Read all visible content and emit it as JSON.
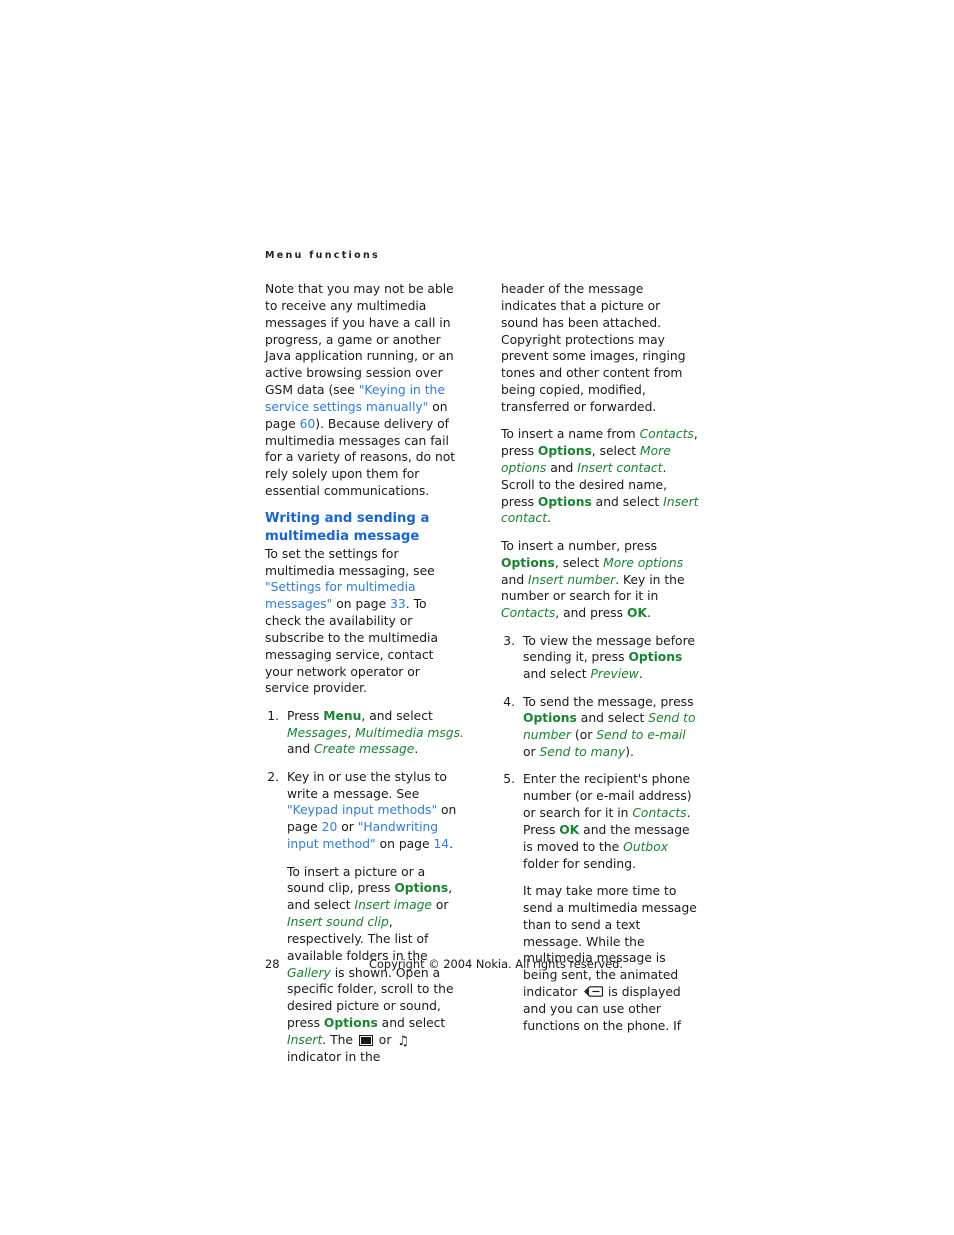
{
  "running_head": "Menu functions",
  "left_column": {
    "intro_paragraph": {
      "part1": "Note that you may not be able to receive any multimedia messages if you have a call in progress, a game or another Java application running, or an active browsing session over GSM data (see ",
      "link1": "\"Keying in the service settings manually\"",
      "part2": " on page ",
      "page1": "60",
      "part3": "). Because delivery of multimedia messages can fail for a variety of reasons, do not rely solely upon them for essential communications."
    },
    "section_title": "Writing and sending a multimedia message",
    "settings_paragraph": {
      "part1": "To set the settings for multimedia messaging, see ",
      "link1": "\"Settings for multimedia messages\"",
      "part2": " on page ",
      "page1": "33",
      "part3": ". To check the availability or subscribe to the multimedia messaging service, contact your network operator or service provider."
    },
    "steps": [
      {
        "num": "1.",
        "part1": "Press ",
        "key1": "Menu",
        "part2": ", and select ",
        "menu1": "Messages",
        "part3": ", ",
        "menu2": "Multimedia msgs.",
        "part4": " and ",
        "menu3": "Create message",
        "part5": "."
      },
      {
        "num": "2.",
        "p1_part1": "Key in or use the stylus to write a message. See ",
        "p1_link1": "\"Keypad input methods\"",
        "p1_part2": " on page ",
        "p1_page1": "20",
        "p1_part3": " or ",
        "p1_link2": "\"Handwriting input method\"",
        "p1_part4": " on page ",
        "p1_page2": "14",
        "p1_part5": ".",
        "p2_part1": "To insert a picture or a sound clip, press ",
        "p2_key1": "Options",
        "p2_part2": ", and select ",
        "p2_menu1": "Insert image",
        "p2_part3": " or ",
        "p2_menu2": "Insert sound clip",
        "p2_part4": ", respectively. The list of available folders in the ",
        "p2_menu3": "Gallery",
        "p2_part5": " is shown. Open a specific folder, scroll to the desired picture or sound, press ",
        "p2_key2": "Options",
        "p2_part6": " and select ",
        "p2_menu4": "Insert",
        "p2_part7": ". The ",
        "p2_icon1": "picture-indicator-icon",
        "p2_part8": " or ",
        "p2_icon2": "music-note-icon",
        "p2_part9": " indicator in the "
      }
    ]
  },
  "right_column": {
    "continued_paragraph": "header of the message indicates that a picture or sound has been attached. Copyright protections may prevent some images, ringing tones and other content from being copied, modified, transferred or forwarded.",
    "insert_name_paragraph": {
      "part1": "To insert a name from ",
      "menu1": "Contacts",
      "part2": ", press ",
      "key1": "Options",
      "part3": ", select ",
      "menu2": "More options",
      "part4": " and ",
      "menu3": "Insert contact",
      "part5": ". Scroll to the desired name, press ",
      "key2": "Options",
      "part6": " and select ",
      "menu4": "Insert contact",
      "part7": "."
    },
    "insert_number_paragraph": {
      "part1": "To insert a number, press ",
      "key1": "Options",
      "part2": ", select ",
      "menu1": "More options",
      "part3": " and ",
      "menu2": "Insert number",
      "part4": ". Key in the number or search for it in ",
      "menu3": "Contacts",
      "part5": ", and press ",
      "key2": "OK",
      "part6": "."
    },
    "steps": [
      {
        "num": "3.",
        "part1": "To view the message before sending it, press ",
        "key1": "Options",
        "part2": " and select ",
        "menu1": "Preview",
        "part3": "."
      },
      {
        "num": "4.",
        "part1": "To send the message, press ",
        "key1": "Options",
        "part2": " and select ",
        "menu1": "Send to number",
        "part3": " (or ",
        "menu2": "Send to e-mail",
        "part4": " or ",
        "menu3": "Send to many",
        "part5": ")."
      },
      {
        "num": "5.",
        "p1_part1": "Enter the recipient's phone number (or e-mail address) or search for it in ",
        "p1_menu1": "Contacts",
        "p1_part2": ". Press ",
        "p1_key1": "OK",
        "p1_part3": " and the message is moved to the ",
        "p1_menu2": "Outbox",
        "p1_part4": " folder for sending.",
        "p2_part1": "It may take more time to send a multimedia message than to send a text message. While the multimedia message is being sent, the animated indicator ",
        "p2_icon1": "sending-envelope-icon",
        "p2_part2": " is displayed and you can use other functions on the phone. If"
      }
    ]
  },
  "footer": {
    "page_number": "28",
    "copyright": "Copyright © 2004 Nokia. All rights reserved."
  },
  "colors": {
    "link_blue": "#2b7de0",
    "heading_blue": "#1466d8",
    "menu_green": "#16862e",
    "body_black": "#1a1a1a",
    "page_background": "#ffffff"
  }
}
